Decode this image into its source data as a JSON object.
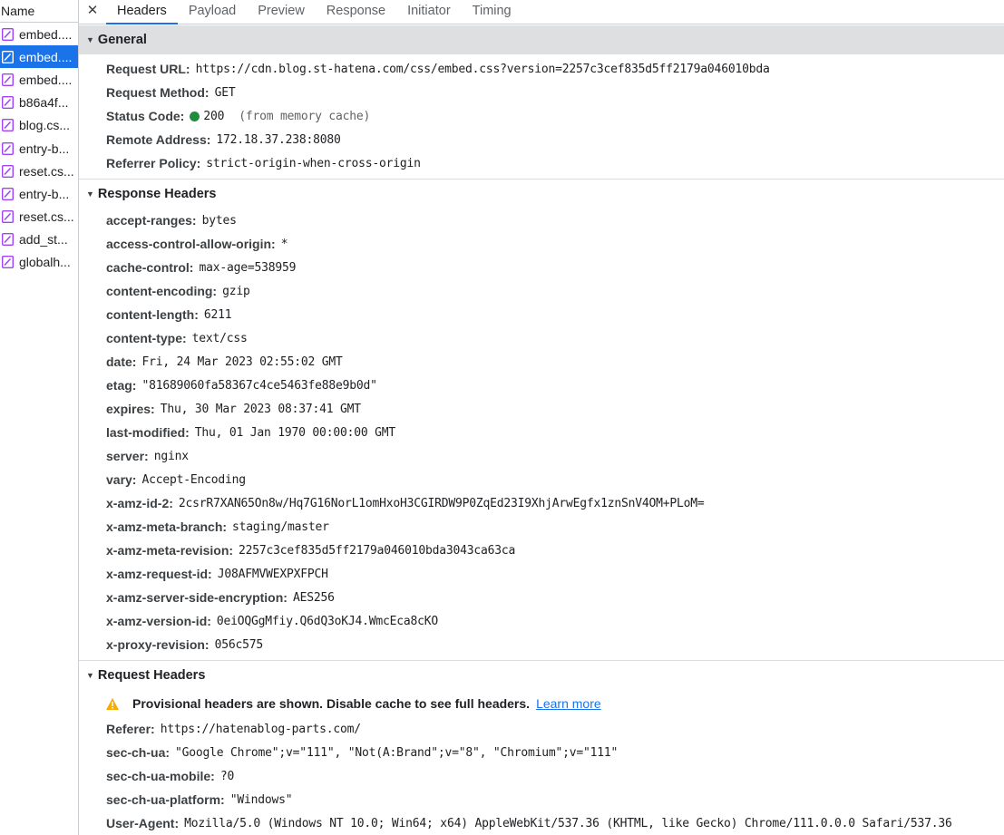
{
  "file_list": {
    "header": "Name",
    "items": [
      {
        "label": "embed....",
        "selected": false
      },
      {
        "label": "embed....",
        "selected": true
      },
      {
        "label": "embed....",
        "selected": false
      },
      {
        "label": "b86a4f...",
        "selected": false
      },
      {
        "label": "blog.cs...",
        "selected": false
      },
      {
        "label": "entry-b...",
        "selected": false
      },
      {
        "label": "reset.cs...",
        "selected": false
      },
      {
        "label": "entry-b...",
        "selected": false
      },
      {
        "label": "reset.cs...",
        "selected": false
      },
      {
        "label": "add_st...",
        "selected": false
      },
      {
        "label": "globalh...",
        "selected": false
      }
    ]
  },
  "tabs": {
    "close": "✕",
    "items": [
      "Headers",
      "Payload",
      "Preview",
      "Response",
      "Initiator",
      "Timing"
    ],
    "active": "Headers"
  },
  "general": {
    "title": "General",
    "request_url_key": "Request URL:",
    "request_url": "https://cdn.blog.st-hatena.com/css/embed.css?version=2257c3cef835d5ff2179a046010bda",
    "request_method_key": "Request Method:",
    "request_method": "GET",
    "status_code_key": "Status Code:",
    "status_code": "200",
    "status_note": "(from memory cache)",
    "remote_address_key": "Remote Address:",
    "remote_address": "172.18.37.238:8080",
    "referrer_policy_key": "Referrer Policy:",
    "referrer_policy": "strict-origin-when-cross-origin"
  },
  "response_headers": {
    "title": "Response Headers",
    "rows": [
      {
        "key": "accept-ranges:",
        "value": "bytes"
      },
      {
        "key": "access-control-allow-origin:",
        "value": "*"
      },
      {
        "key": "cache-control:",
        "value": "max-age=538959"
      },
      {
        "key": "content-encoding:",
        "value": "gzip"
      },
      {
        "key": "content-length:",
        "value": "6211"
      },
      {
        "key": "content-type:",
        "value": "text/css"
      },
      {
        "key": "date:",
        "value": "Fri, 24 Mar 2023 02:55:02 GMT"
      },
      {
        "key": "etag:",
        "value": "\"81689060fa58367c4ce5463fe88e9b0d\""
      },
      {
        "key": "expires:",
        "value": "Thu, 30 Mar 2023 08:37:41 GMT"
      },
      {
        "key": "last-modified:",
        "value": "Thu, 01 Jan 1970 00:00:00 GMT"
      },
      {
        "key": "server:",
        "value": "nginx"
      },
      {
        "key": "vary:",
        "value": "Accept-Encoding"
      },
      {
        "key": "x-amz-id-2:",
        "value": "2csrR7XAN65On8w/Hq7G16NorL1omHxoH3CGIRDW9P0ZqEd23I9XhjArwEgfx1znSnV4OM+PLoM="
      },
      {
        "key": "x-amz-meta-branch:",
        "value": "staging/master"
      },
      {
        "key": "x-amz-meta-revision:",
        "value": "2257c3cef835d5ff2179a046010bda3043ca63ca"
      },
      {
        "key": "x-amz-request-id:",
        "value": "J08AFMVWEXPXFPCH"
      },
      {
        "key": "x-amz-server-side-encryption:",
        "value": "AES256"
      },
      {
        "key": "x-amz-version-id:",
        "value": "0eiOQGgMfiy.Q6dQ3oKJ4.WmcEca8cKO"
      },
      {
        "key": "x-proxy-revision:",
        "value": "056c575"
      }
    ]
  },
  "request_headers": {
    "title": "Request Headers",
    "warning_text": "Provisional headers are shown. Disable cache to see full headers.",
    "learn_more": "Learn more",
    "rows": [
      {
        "key": "Referer:",
        "value": "https://hatenablog-parts.com/"
      },
      {
        "key": "sec-ch-ua:",
        "value": "\"Google Chrome\";v=\"111\", \"Not(A:Brand\";v=\"8\", \"Chromium\";v=\"111\""
      },
      {
        "key": "sec-ch-ua-mobile:",
        "value": "?0"
      },
      {
        "key": "sec-ch-ua-platform:",
        "value": "\"Windows\""
      },
      {
        "key": "User-Agent:",
        "value": "Mozilla/5.0 (Windows NT 10.0; Win64; x64) AppleWebKit/537.36 (KHTML, like Gecko) Chrome/111.0.0.0 Safari/537.36"
      }
    ]
  },
  "colors": {
    "accent": "#1a73e8",
    "status_ok": "#1e8e3e",
    "warning": "#f9ab00",
    "file_icon": "#a142f4"
  }
}
